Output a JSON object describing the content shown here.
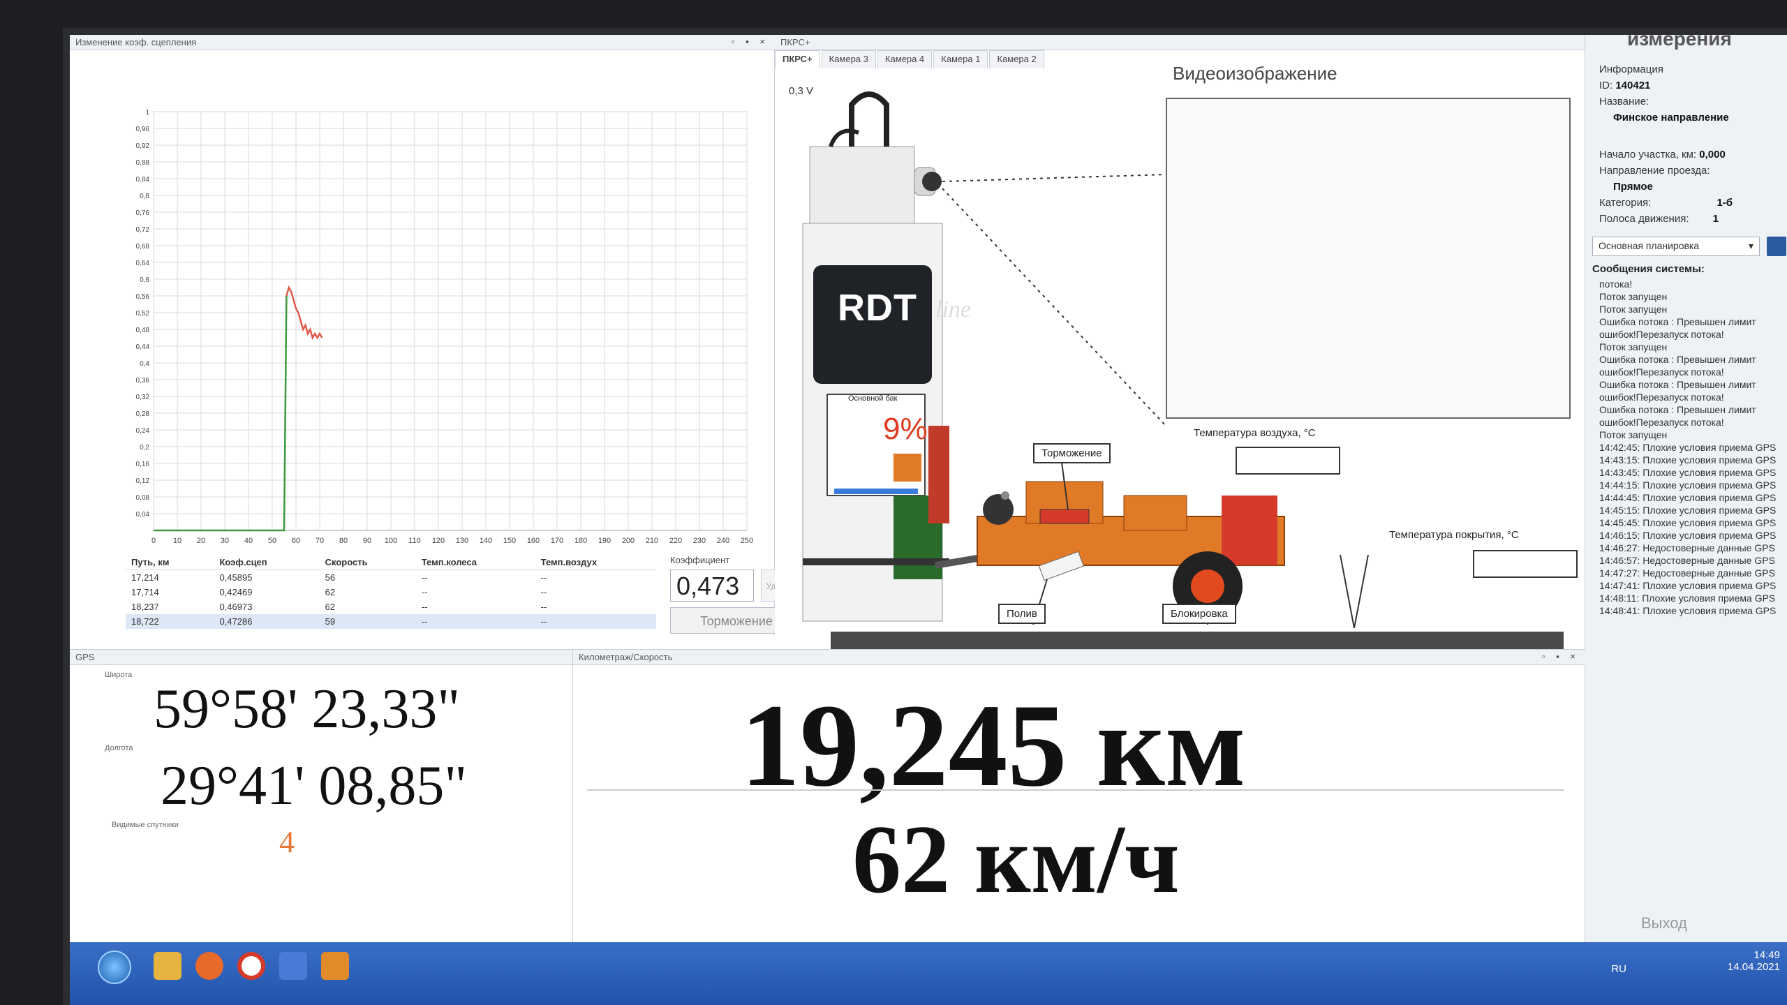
{
  "chart_panel": {
    "title": "Изменение коэф. сцепления",
    "window_controls": "▫ ▪ ×",
    "readings": {
      "headers": [
        "Путь, км",
        "Коэф.сцеп",
        "Скорость",
        "Темп.колеса",
        "Темп.воздух"
      ],
      "rows": [
        [
          "17,214",
          "0,45895",
          "56",
          "--",
          "--"
        ],
        [
          "17,714",
          "0,42469",
          "62",
          "--",
          "--"
        ],
        [
          "18,237",
          "0,46973",
          "62",
          "--",
          "--"
        ],
        [
          "18,722",
          "0,47286",
          "59",
          "--",
          "--"
        ]
      ]
    },
    "coefficient": {
      "label": "Коэффициент",
      "value": "0,473",
      "remove_label": "Удалить",
      "brake_label": "Торможение"
    }
  },
  "chart_data": {
    "type": "line",
    "title": "",
    "xlabel": "",
    "ylabel": "",
    "xlim": [
      0,
      250
    ],
    "ylim": [
      0,
      1
    ],
    "x_ticks": [
      0,
      10,
      20,
      30,
      40,
      50,
      60,
      70,
      80,
      90,
      100,
      110,
      120,
      130,
      140,
      150,
      160,
      170,
      180,
      190,
      200,
      210,
      220,
      230,
      240,
      250
    ],
    "y_ticks": [
      0.04,
      0.08,
      0.12,
      0.16,
      0.2,
      0.24,
      0.28,
      0.32,
      0.36,
      0.4,
      0.44,
      0.48,
      0.52,
      0.56,
      0.6,
      0.64,
      0.68,
      0.72,
      0.76,
      0.8,
      0.84,
      0.88,
      0.92,
      0.96,
      1
    ],
    "grid": true,
    "series": [
      {
        "color": "#3a9a3a",
        "x": [
          0,
          20,
          40,
          50,
          55,
          56
        ],
        "y": [
          0.0,
          0.0,
          0.0,
          0.0,
          0.0,
          0.56
        ]
      },
      {
        "color": "#e05a4a",
        "x": [
          56,
          57,
          58,
          59,
          60,
          61,
          62,
          63,
          64,
          65,
          66,
          67,
          68,
          69,
          70,
          71
        ],
        "y": [
          0.56,
          0.58,
          0.57,
          0.55,
          0.53,
          0.52,
          0.5,
          0.48,
          0.49,
          0.47,
          0.48,
          0.46,
          0.47,
          0.46,
          0.47,
          0.46
        ]
      }
    ]
  },
  "pkrs_panel": {
    "title": "ПКРС+",
    "tabs": [
      "ПКРС+",
      "Камера 3",
      "Камера 4",
      "Камера 1",
      "Камера 2"
    ],
    "active_tab": 0,
    "voltage": "0,3 V",
    "video_title": "Видеоизображение",
    "brand": "RDT",
    "brand_sub": "line",
    "tank_label": "Основной бак",
    "tank_percent": "9%",
    "callouts": {
      "braking": "Торможение",
      "air_temp_label": "Температура воздуха, °C",
      "air_temp_value": "",
      "surface_temp_label": "Температура покрытия, °C",
      "surface_temp_value": "",
      "watering": "Полив",
      "lock": "Блокировка"
    },
    "colors": {
      "trailer": "#e07a26",
      "accent": "#d63a2a"
    }
  },
  "info_panel": {
    "header": "измерения",
    "info_label": "Информация",
    "id_label": "ID:",
    "id_value": "140421",
    "name_label": "Название:",
    "name_value": "Финское направление",
    "start_label": "Начало участка, км:",
    "start_value": "0,000",
    "direction_label": "Направление проезда:",
    "direction_value": "Прямое",
    "category_label": "Категория:",
    "category_value": "1-б",
    "lane_label": "Полоса движения:",
    "lane_value": "1",
    "layout_select": "Основная планировка",
    "messages_title": "Сообщения системы:",
    "messages": [
      "потока!",
      "Поток запущен",
      "Поток запущен",
      "Ошибка потока : Превышен лимит ошибок!Перезапуск потока!",
      "Поток запущен",
      "Ошибка потока : Превышен лимит ошибок!Перезапуск потока!",
      "Ошибка потока : Превышен лимит ошибок!Перезапуск потока!",
      "Ошибка потока : Превышен лимит ошибок!Перезапуск потока!",
      "Поток запущен",
      "14:42:45: Плохие условия приема GPS",
      "14:43:15: Плохие условия приема GPS",
      "14:43:45: Плохие условия приема GPS",
      "14:44:15: Плохие условия приема GPS",
      "14:44:45: Плохие условия приема GPS",
      "14:45:15: Плохие условия приема GPS",
      "14:45:45: Плохие условия приема GPS",
      "14:46:15: Плохие условия приема GPS",
      "14:46:27: Недостоверные данные GPS",
      "14:46:57: Недостоверные данные GPS",
      "14:47:27: Недостоверные данные GPS",
      "14:47:41: Плохие условия приема GPS",
      "14:48:11: Плохие условия приема GPS",
      "14:48:41: Плохие условия приема GPS"
    ],
    "exit_label": "Выход"
  },
  "gps_panel": {
    "title": "GPS",
    "lat_label": "Широта",
    "latitude": "59°58' 23,33\"",
    "lon_label": "Долгота",
    "longitude": "29°41' 08,85\"",
    "sats_label": "Видимые спутники",
    "satellites": "4"
  },
  "odo_panel": {
    "title": "Километраж/Скорость",
    "distance": "19,245 км",
    "speed": "62 км/ч"
  },
  "taskbar": {
    "lang": "RU",
    "time": "14:49",
    "date": "14.04.2021"
  }
}
